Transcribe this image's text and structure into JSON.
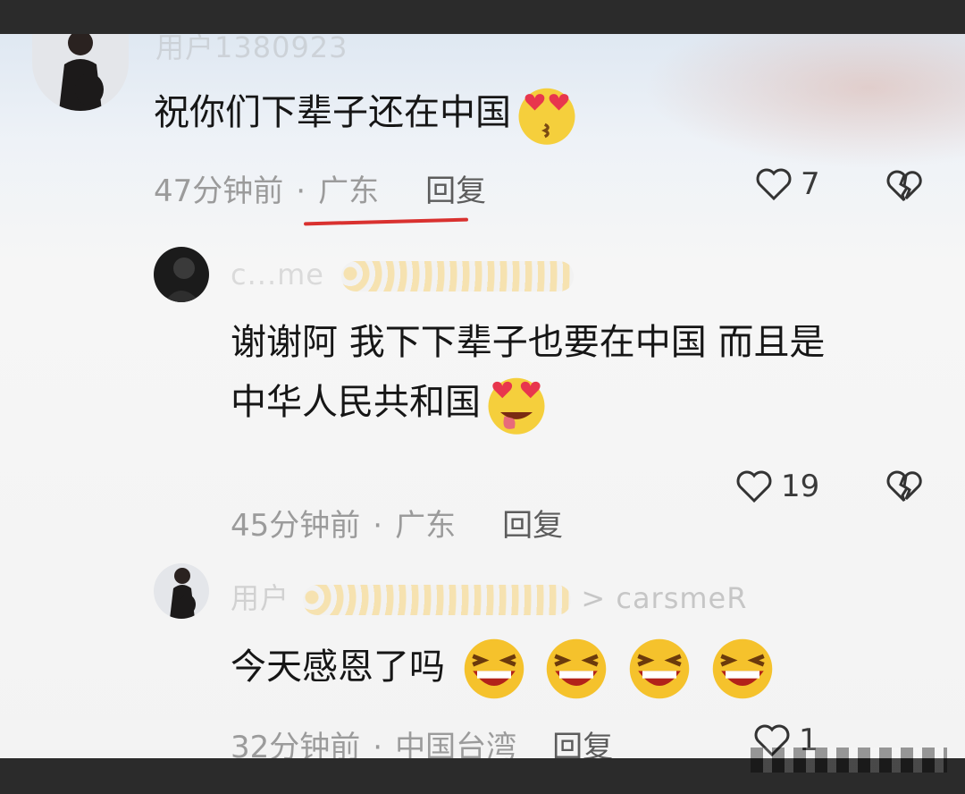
{
  "comments": [
    {
      "name": "用户1380923",
      "text": "祝你们下辈子还在中国",
      "emoji": "heart-eyes-kiss-emoji",
      "time": "47分钟前",
      "location": "广东",
      "reply": "回复",
      "likes": "7"
    },
    {
      "name": "c...me",
      "text_line1": "谢谢阿 我下下辈子也要在中国 而且是",
      "text_line2": "中华人民共和国",
      "emoji": "heart-eyes-tongue-emoji",
      "time": "45分钟前",
      "location": "广东",
      "reply": "回复",
      "likes": "19"
    },
    {
      "name": "用户",
      "reply_to": "> carsmeR",
      "text": "今天感恩了吗",
      "emoji": "laughing-emoji",
      "emoji_count": 4,
      "time": "32分钟前",
      "location": "中国台湾",
      "reply": "回复",
      "likes": "1"
    }
  ],
  "colors": {
    "underline": "#d9312f",
    "meta": "#9b9b9b",
    "text": "#161616"
  }
}
